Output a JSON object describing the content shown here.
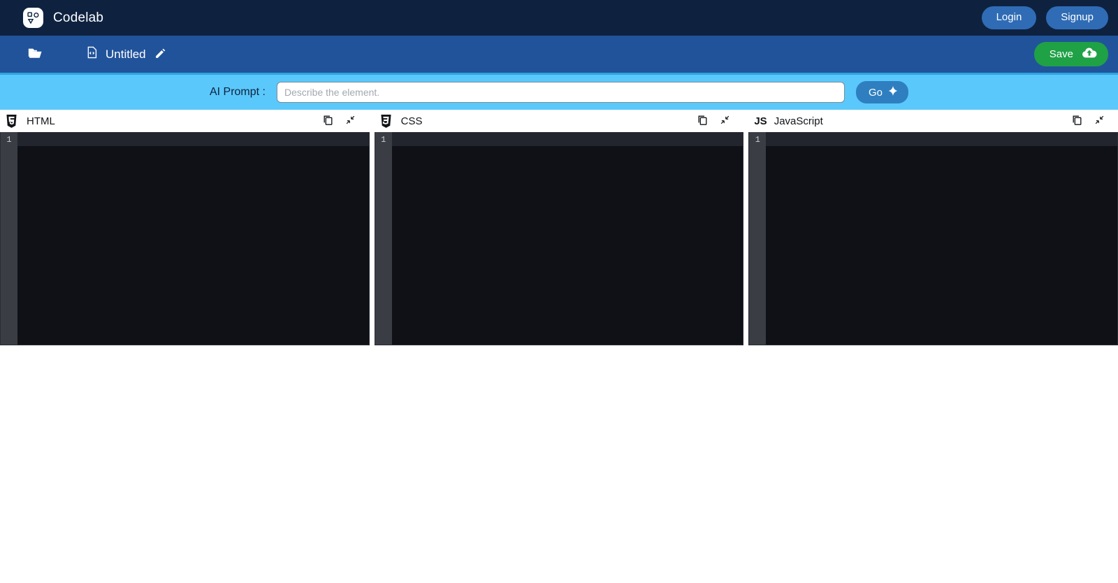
{
  "navbar": {
    "logo_icon": "codelab-shapes-icon",
    "brand": "Codelab",
    "login_label": "Login",
    "signup_label": "Signup",
    "bg_color": "#0e2240",
    "button_color": "#2f6cb5"
  },
  "toolbar": {
    "folder_icon": "open-folder-icon",
    "file_icon": "code-file-icon",
    "file_name": "Untitled",
    "edit_icon": "pencil-icon",
    "save_label": "Save",
    "save_icon": "cloud-upload-icon",
    "bg_color": "#21539b",
    "save_color": "#1fa146"
  },
  "prompt": {
    "label": "AI Prompt :",
    "placeholder": "Describe the element.",
    "value": "",
    "go_label": "Go",
    "go_icon": "sparkle-icon",
    "bg_color": "#5ac8fa",
    "go_color": "#2f7fc0"
  },
  "editors": [
    {
      "id": "html",
      "title": "HTML",
      "lang_icon": "html5-shield-icon",
      "copy_icon": "copy-icon",
      "collapse_icon": "collapse-arrows-icon",
      "line_numbers": [
        "1"
      ],
      "code": ""
    },
    {
      "id": "css",
      "title": "CSS",
      "lang_icon": "css3-shield-icon",
      "copy_icon": "copy-icon",
      "collapse_icon": "collapse-arrows-icon",
      "line_numbers": [
        "1"
      ],
      "code": ""
    },
    {
      "id": "javascript",
      "title": "JavaScript",
      "lang_tag": "JS",
      "lang_icon": "js-text-icon",
      "copy_icon": "copy-icon",
      "collapse_icon": "collapse-arrows-icon",
      "line_numbers": [
        "1"
      ],
      "code": ""
    }
  ]
}
